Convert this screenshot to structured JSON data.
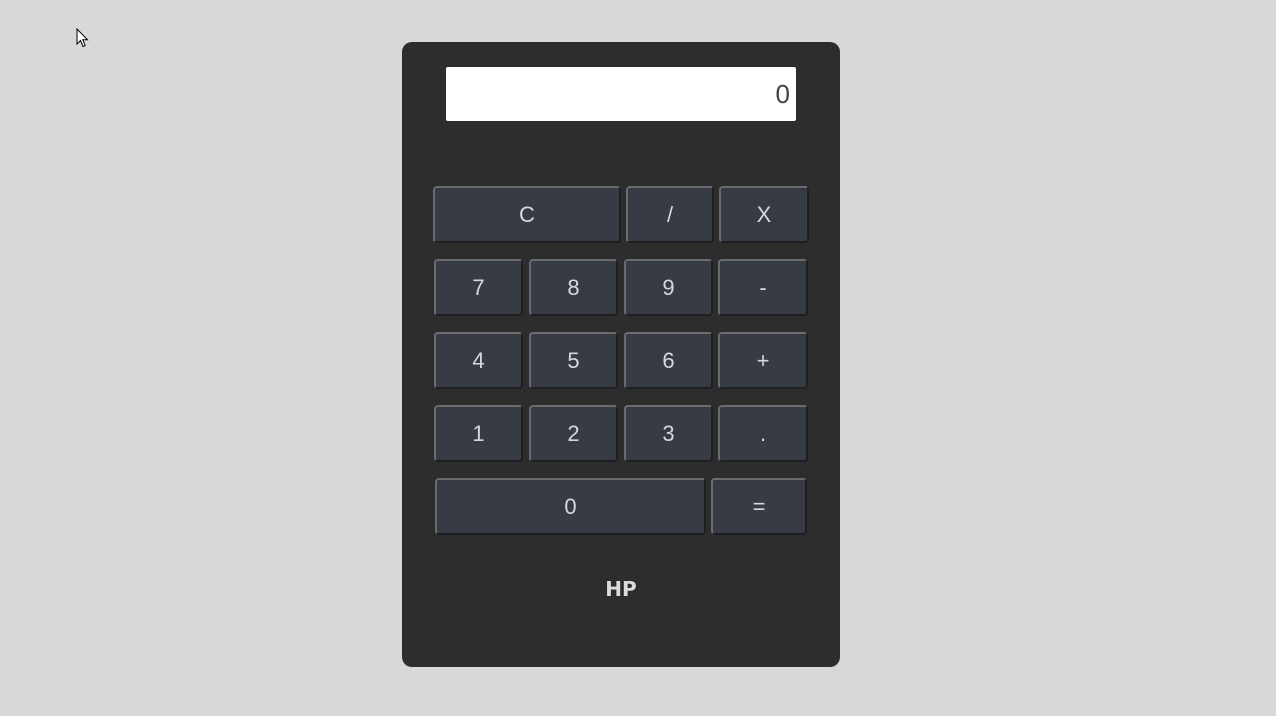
{
  "display": {
    "value": "0"
  },
  "keys": {
    "clear": "C",
    "divide": "/",
    "multiply": "X",
    "seven": "7",
    "eight": "8",
    "nine": "9",
    "minus": "-",
    "four": "4",
    "five": "5",
    "six": "6",
    "plus": "+",
    "one": "1",
    "two": "2",
    "three": "3",
    "decimal": ".",
    "zero": "0",
    "equals": "="
  },
  "brand": "HP",
  "colors": {
    "page_background": "#d8d8d8",
    "calculator_body": "#2d2d2d",
    "key_face": "#373b43",
    "key_text": "#d8d8d8",
    "display_background": "#ffffff"
  },
  "icons": {
    "cursor": "mouse-pointer-icon"
  }
}
